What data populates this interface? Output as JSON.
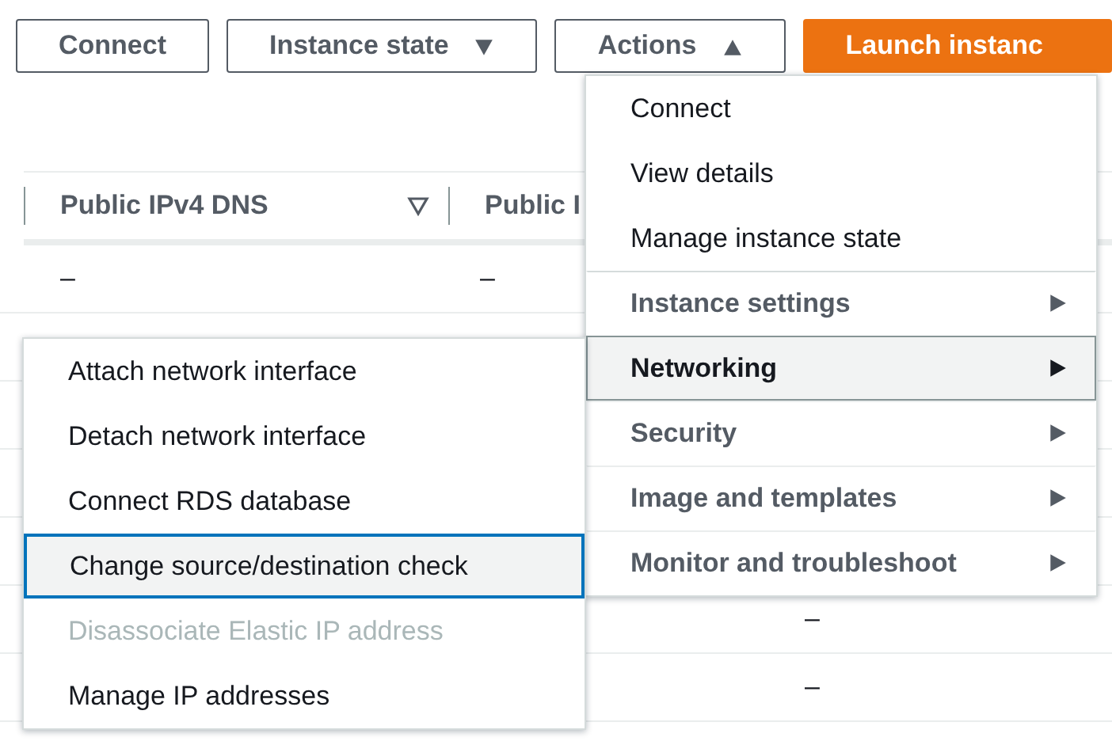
{
  "toolbar": {
    "buttons": [
      {
        "label": "Connect",
        "kind": "plain"
      },
      {
        "label": "Instance state",
        "kind": "dropdown",
        "expanded": false
      },
      {
        "label": "Actions",
        "kind": "dropdown",
        "expanded": true
      },
      {
        "label": "Launch instanc",
        "kind": "primary"
      }
    ]
  },
  "table": {
    "columns": [
      {
        "label": "Public IPv4 DNS",
        "filter": true
      },
      {
        "label": "Public I"
      }
    ],
    "rows": [
      {
        "cells": {
          "public_ipv4_dns": "–",
          "public_i": "–"
        }
      },
      {},
      {},
      {},
      {},
      {
        "cells": {
          "column_3": "–"
        }
      },
      {
        "cells": {
          "column_3": "–"
        }
      }
    ]
  },
  "actions_menu": {
    "items": [
      {
        "label": "Connect",
        "kind": "action",
        "selected": false
      },
      {
        "label": "View details",
        "kind": "action",
        "selected": false
      },
      {
        "label": "Manage instance state",
        "kind": "action",
        "selected": false
      },
      {
        "label": "Instance settings",
        "kind": "submenu",
        "selected": false
      },
      {
        "label": "Networking",
        "kind": "submenu",
        "selected": true
      },
      {
        "label": "Security",
        "kind": "submenu",
        "selected": false
      },
      {
        "label": "Image and templates",
        "kind": "submenu",
        "selected": false
      },
      {
        "label": "Monitor and troubleshoot",
        "kind": "submenu",
        "selected": false
      }
    ]
  },
  "networking_submenu": {
    "items": [
      {
        "label": "Attach network interface",
        "disabled": false,
        "focused": false
      },
      {
        "label": "Detach network interface",
        "disabled": false,
        "focused": false
      },
      {
        "label": "Connect RDS database",
        "disabled": false,
        "focused": false
      },
      {
        "label": "Change source/destination check",
        "disabled": false,
        "focused": true
      },
      {
        "label": "Disassociate Elastic IP address",
        "disabled": true,
        "focused": false
      },
      {
        "label": "Manage IP addresses",
        "disabled": false,
        "focused": false
      }
    ]
  }
}
